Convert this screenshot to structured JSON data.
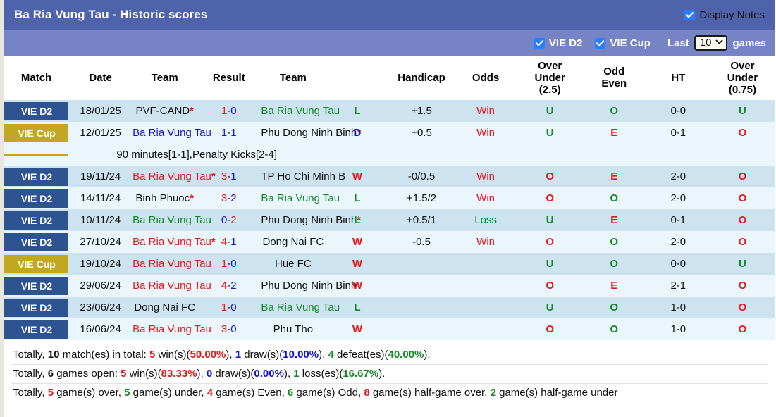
{
  "header": {
    "title": "Ba Ria Vung Tau - Historic scores",
    "display_notes_label": "Display Notes",
    "display_notes_checked": true,
    "filters": [
      {
        "label": "VIE D2",
        "checked": true
      },
      {
        "label": "VIE Cup",
        "checked": true
      }
    ],
    "last_label": "Last",
    "games_count": "10",
    "games_label": "games",
    "select_caret": "⌄",
    "colors": {
      "titlebar": "#4f63ac",
      "filterbar": "#7683c4",
      "checkbox": "#2b7fff",
      "badge_league": "#2d5490",
      "badge_cup": "#c2a820",
      "win": "#e8161c",
      "loss": "#108a23",
      "draw": "#1414d2"
    }
  },
  "table": {
    "columns": [
      {
        "key": "match",
        "label": "Match"
      },
      {
        "key": "date",
        "label": "Date"
      },
      {
        "key": "home",
        "label": "Team"
      },
      {
        "key": "result",
        "label": "Result"
      },
      {
        "key": "away",
        "label": "Team"
      },
      {
        "key": "wdl",
        "label": ""
      },
      {
        "key": "handicap",
        "label": "Handicap"
      },
      {
        "key": "odds",
        "label": "Odds"
      },
      {
        "key": "ou25",
        "label": "Over\nUnder\n(2.5)",
        "line1": "Over",
        "line2": "Under",
        "line3": "(2.5)"
      },
      {
        "key": "oddeven",
        "label": "Odd\nEven",
        "line1": "Odd",
        "line2": "Even"
      },
      {
        "key": "ht",
        "label": "HT"
      },
      {
        "key": "ou075",
        "label": "Over\nUnder\n(0.75)",
        "line1": "Over",
        "line2": "Under",
        "line3": "(0.75)"
      }
    ],
    "rows": [
      {
        "competition": "VIE D2",
        "competition_type": "league",
        "date": "18/01/25",
        "home": "PVF-CAND",
        "home_star": true,
        "home_color": "n",
        "score_home": "1",
        "score_sep": "-",
        "score_away": "0",
        "score_home_color": "w",
        "score_away_color": "d",
        "away": "Ba Ria Vung Tau",
        "away_star": false,
        "away_color": "l",
        "wdl": "L",
        "wdl_color": "l",
        "handicap": "+1.5",
        "odds": "Win",
        "odds_color": "w",
        "ou25": "U",
        "ou25_color": "l",
        "oddeven": "O",
        "oddeven_color": "l",
        "ht": "0-0",
        "ou075": "U",
        "ou075_color": "l",
        "note": null
      },
      {
        "competition": "VIE Cup",
        "competition_type": "cup",
        "date": "12/01/25",
        "home": "Ba Ria Vung Tau",
        "home_star": false,
        "home_color": "d",
        "score_home": "1",
        "score_sep": "-",
        "score_away": "1",
        "score_home_color": "d",
        "score_away_color": "d",
        "away": "Phu Dong Ninh Binh",
        "away_star": true,
        "away_color": "n",
        "wdl": "D",
        "wdl_color": "d",
        "handicap": "+0.5",
        "odds": "Win",
        "odds_color": "w",
        "ou25": "U",
        "ou25_color": "l",
        "oddeven": "E",
        "oddeven_color": "w",
        "ht": "0-1",
        "ou075": "O",
        "ou075_color": "w",
        "note": "90 minutes[1-1],Penalty Kicks[2-4]"
      },
      {
        "competition": "VIE D2",
        "competition_type": "league",
        "date": "19/11/24",
        "home": "Ba Ria Vung Tau",
        "home_star": true,
        "home_color": "w",
        "score_home": "3",
        "score_sep": "-",
        "score_away": "1",
        "score_home_color": "w",
        "score_away_color": "d",
        "away": "TP Ho Chi Minh B",
        "away_star": false,
        "away_color": "n",
        "wdl": "W",
        "wdl_color": "w",
        "handicap": "-0/0.5",
        "odds": "Win",
        "odds_color": "w",
        "ou25": "O",
        "ou25_color": "w",
        "oddeven": "E",
        "oddeven_color": "w",
        "ht": "2-0",
        "ou075": "O",
        "ou075_color": "w",
        "note": null
      },
      {
        "competition": "VIE D2",
        "competition_type": "league",
        "date": "14/11/24",
        "home": "Binh Phuoc",
        "home_star": true,
        "home_color": "n",
        "score_home": "3",
        "score_sep": "-",
        "score_away": "2",
        "score_home_color": "w",
        "score_away_color": "d",
        "away": "Ba Ria Vung Tau",
        "away_star": false,
        "away_color": "l",
        "wdl": "L",
        "wdl_color": "l",
        "handicap": "+1.5/2",
        "odds": "Win",
        "odds_color": "w",
        "ou25": "O",
        "ou25_color": "w",
        "oddeven": "O",
        "oddeven_color": "l",
        "ht": "2-0",
        "ou075": "O",
        "ou075_color": "w",
        "note": null
      },
      {
        "competition": "VIE D2",
        "competition_type": "league",
        "date": "10/11/24",
        "home": "Ba Ria Vung Tau",
        "home_star": false,
        "home_color": "l",
        "score_home": "0",
        "score_sep": "-",
        "score_away": "2",
        "score_home_color": "d",
        "score_away_color": "w",
        "away": "Phu Dong Ninh Binh",
        "away_star": true,
        "away_color": "n",
        "wdl": "L",
        "wdl_color": "l",
        "handicap": "+0.5/1",
        "odds": "Loss",
        "odds_color": "l",
        "ou25": "U",
        "ou25_color": "l",
        "oddeven": "E",
        "oddeven_color": "w",
        "ht": "0-1",
        "ou075": "O",
        "ou075_color": "w",
        "note": null
      },
      {
        "competition": "VIE D2",
        "competition_type": "league",
        "date": "27/10/24",
        "home": "Ba Ria Vung Tau",
        "home_star": true,
        "home_color": "w",
        "score_home": "4",
        "score_sep": "-",
        "score_away": "1",
        "score_home_color": "w",
        "score_away_color": "d",
        "away": "Dong Nai FC",
        "away_star": false,
        "away_color": "n",
        "wdl": "W",
        "wdl_color": "w",
        "handicap": "-0.5",
        "odds": "Win",
        "odds_color": "w",
        "ou25": "O",
        "ou25_color": "w",
        "oddeven": "O",
        "oddeven_color": "l",
        "ht": "2-0",
        "ou075": "O",
        "ou075_color": "w",
        "note": null
      },
      {
        "competition": "VIE Cup",
        "competition_type": "cup",
        "date": "19/10/24",
        "home": "Ba Ria Vung Tau",
        "home_star": false,
        "home_color": "w",
        "score_home": "1",
        "score_sep": "-",
        "score_away": "0",
        "score_home_color": "w",
        "score_away_color": "d",
        "away": "Hue FC",
        "away_star": false,
        "away_color": "n",
        "wdl": "W",
        "wdl_color": "w",
        "handicap": "",
        "odds": "",
        "odds_color": "n",
        "ou25": "U",
        "ou25_color": "l",
        "oddeven": "O",
        "oddeven_color": "l",
        "ht": "0-0",
        "ou075": "U",
        "ou075_color": "l",
        "note": null
      },
      {
        "competition": "VIE D2",
        "competition_type": "league",
        "date": "29/06/24",
        "home": "Ba Ria Vung Tau",
        "home_star": false,
        "home_color": "w",
        "score_home": "4",
        "score_sep": "-",
        "score_away": "2",
        "score_home_color": "w",
        "score_away_color": "d",
        "away": "Phu Dong Ninh Binh",
        "away_star": false,
        "away_color": "n",
        "wdl": "W",
        "wdl_color": "w",
        "handicap": "",
        "odds": "",
        "odds_color": "n",
        "ou25": "O",
        "ou25_color": "w",
        "oddeven": "E",
        "oddeven_color": "w",
        "ht": "2-1",
        "ou075": "O",
        "ou075_color": "w",
        "note": null
      },
      {
        "competition": "VIE D2",
        "competition_type": "league",
        "date": "23/06/24",
        "home": "Dong Nai FC",
        "home_star": false,
        "home_color": "n",
        "score_home": "1",
        "score_sep": "-",
        "score_away": "0",
        "score_home_color": "w",
        "score_away_color": "d",
        "away": "Ba Ria Vung Tau",
        "away_star": false,
        "away_color": "l",
        "wdl": "L",
        "wdl_color": "l",
        "handicap": "",
        "odds": "",
        "odds_color": "n",
        "ou25": "U",
        "ou25_color": "l",
        "oddeven": "O",
        "oddeven_color": "l",
        "ht": "1-0",
        "ou075": "O",
        "ou075_color": "w",
        "note": null
      },
      {
        "competition": "VIE D2",
        "competition_type": "league",
        "date": "16/06/24",
        "home": "Ba Ria Vung Tau",
        "home_star": false,
        "home_color": "w",
        "score_home": "3",
        "score_sep": "-",
        "score_away": "0",
        "score_home_color": "w",
        "score_away_color": "d",
        "away": "Phu Tho",
        "away_star": false,
        "away_color": "n",
        "wdl": "W",
        "wdl_color": "w",
        "handicap": "",
        "odds": "",
        "odds_color": "n",
        "ou25": "O",
        "ou25_color": "w",
        "oddeven": "O",
        "oddeven_color": "l",
        "ht": "1-0",
        "ou075": "O",
        "ou075_color": "w",
        "note": null
      }
    ]
  },
  "summary": {
    "line1": [
      {
        "t": "Totally, ",
        "c": "plain"
      },
      {
        "t": "10",
        "c": "fk"
      },
      {
        "t": " match(es) in total: ",
        "c": "plain"
      },
      {
        "t": "5",
        "c": "fr"
      },
      {
        "t": " win(s)(",
        "c": "plain"
      },
      {
        "t": "50.00%",
        "c": "fr"
      },
      {
        "t": "), ",
        "c": "plain"
      },
      {
        "t": "1",
        "c": "fb"
      },
      {
        "t": " draw(s)(",
        "c": "plain"
      },
      {
        "t": "10.00%",
        "c": "fb"
      },
      {
        "t": "), ",
        "c": "plain"
      },
      {
        "t": "4",
        "c": "fg"
      },
      {
        "t": " defeat(es)(",
        "c": "plain"
      },
      {
        "t": "40.00%",
        "c": "fg"
      },
      {
        "t": ").",
        "c": "plain"
      }
    ],
    "line2": [
      {
        "t": "Totally, ",
        "c": "plain"
      },
      {
        "t": "6",
        "c": "fk"
      },
      {
        "t": " games open: ",
        "c": "plain"
      },
      {
        "t": "5",
        "c": "fr"
      },
      {
        "t": " win(s)(",
        "c": "plain"
      },
      {
        "t": "83.33%",
        "c": "fr"
      },
      {
        "t": "), ",
        "c": "plain"
      },
      {
        "t": "0",
        "c": "fb"
      },
      {
        "t": " draw(s)(",
        "c": "plain"
      },
      {
        "t": "0.00%",
        "c": "fb"
      },
      {
        "t": "), ",
        "c": "plain"
      },
      {
        "t": "1",
        "c": "fg"
      },
      {
        "t": " loss(es)(",
        "c": "plain"
      },
      {
        "t": "16.67%",
        "c": "fg"
      },
      {
        "t": ").",
        "c": "plain"
      }
    ],
    "line3": [
      {
        "t": "Totally, ",
        "c": "plain"
      },
      {
        "t": "5",
        "c": "fr"
      },
      {
        "t": " game(s) over, ",
        "c": "plain"
      },
      {
        "t": "5",
        "c": "fg"
      },
      {
        "t": " game(s) under, ",
        "c": "plain"
      },
      {
        "t": "4",
        "c": "fr"
      },
      {
        "t": " game(s) Even, ",
        "c": "plain"
      },
      {
        "t": "6",
        "c": "fg"
      },
      {
        "t": " game(s) Odd, ",
        "c": "plain"
      },
      {
        "t": "8",
        "c": "fr"
      },
      {
        "t": " game(s) half-game over, ",
        "c": "plain"
      },
      {
        "t": "2",
        "c": "fg"
      },
      {
        "t": " game(s) half-game under",
        "c": "plain"
      }
    ]
  }
}
